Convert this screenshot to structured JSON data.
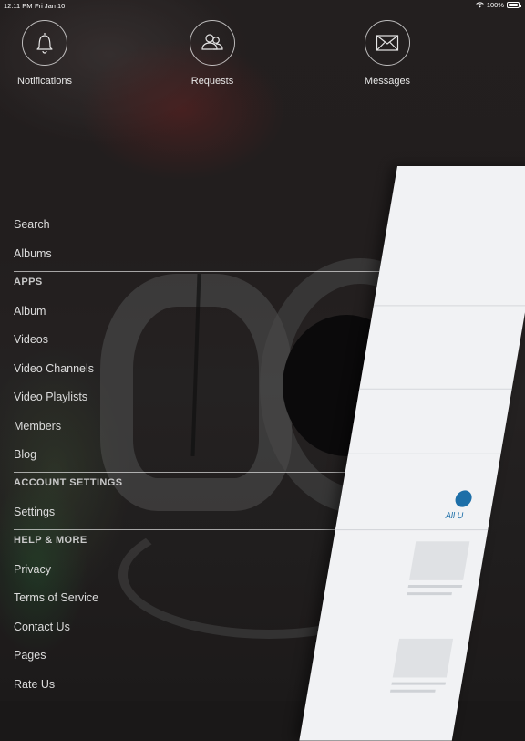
{
  "status_bar": {
    "time": "12:11 PM",
    "date": "Fri Jan 10",
    "battery": "100%"
  },
  "top_actions": [
    {
      "label": "Notifications",
      "icon": "bell-icon"
    },
    {
      "label": "Requests",
      "icon": "users-icon"
    },
    {
      "label": "Messages",
      "icon": "envelope-icon"
    }
  ],
  "menu": {
    "search": "Search",
    "albums": "Albums",
    "apps_header": "APPS",
    "apps": [
      "Album",
      "Videos",
      "Video Channels",
      "Video Playlists",
      "Members",
      "Blog"
    ],
    "account_header": "ACCOUNT SETTINGS",
    "settings": "Settings",
    "help_header": "HELP & MORE",
    "help": [
      "Privacy",
      "Terms of Service",
      "Contact Us",
      "Pages",
      "Rate Us"
    ]
  },
  "panel": {
    "all_label": "All U"
  }
}
